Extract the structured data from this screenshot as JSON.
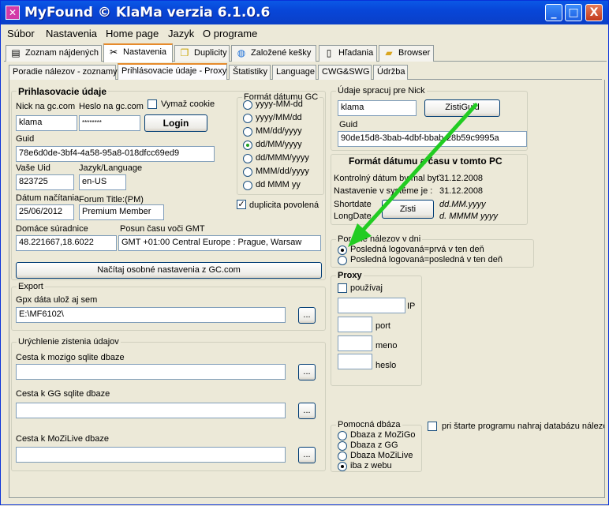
{
  "window": {
    "title": "MyFound © KlaMa verzia 6.1.0.6",
    "app_icon": "app-logo-icon",
    "controls": [
      "_",
      "□",
      "X"
    ]
  },
  "menu": [
    "Súbor",
    "Nastavenia",
    "Home page",
    "Jazyk",
    "O programe"
  ],
  "main_tabs": [
    {
      "label": "Zoznam nájdených",
      "icon": "document-icon"
    },
    {
      "label": "Nastavenia",
      "icon": "tools-icon"
    },
    {
      "label": "Duplicity",
      "icon": "duplicate-icon"
    },
    {
      "label": "Založené kešky",
      "icon": "globe-icon"
    },
    {
      "label": "Hľadania",
      "icon": "page-icon"
    },
    {
      "label": "Browser",
      "icon": "folder-icon"
    }
  ],
  "sub_tabs": [
    "Poradie nálezov - zoznamy",
    "Prihlásovacie údaje - Proxy",
    "Štatistiky",
    "Language",
    "CWG&SWG",
    "Údržba"
  ],
  "login": {
    "title": "Prihlasovacie údaje",
    "nick_label": "Nick na gc.com",
    "nick_value": "klama",
    "password_label": "Heslo na gc.com",
    "password_value": "********",
    "clear_cookie_label": "Vymaž cookie",
    "login_button": "Login",
    "guid_label": "Guid",
    "guid_value": "78e6d0de-3bf4-4a58-95a8-018dfcc69ed9",
    "uid_label": "Vaše Uid",
    "uid_value": "823725",
    "lang_label": "Jazyk/Language",
    "lang_value": "en-US",
    "load_date_label": "Dátum načítania",
    "load_date_value": "25/06/2012",
    "forum_title_label": "Forum Title:(PM)",
    "forum_title_value": "Premium Member",
    "home_coords_label": "Domáce súradnice",
    "home_coords_value": "48.221667,18.6022",
    "gmt_label": "Posun času voči GMT",
    "gmt_value": "GMT +01:00 Central Europe : Prague, Warsaw",
    "load_settings_button": "Načítaj osobné nastavenia z GC.com"
  },
  "date_format": {
    "title": "Formát dátumu GC",
    "options": [
      "yyyy-MM-dd",
      "yyyy/MM/dd",
      "MM/dd/yyyy",
      "dd/MM/yyyy",
      "dd/MMM/yyyy",
      "MMM/dd/yyyy",
      "dd MMM yy"
    ],
    "selected": 3,
    "duplicity_label": "duplicita povolená",
    "duplicity_checked": true
  },
  "export": {
    "title": "Export",
    "gpx_label": "Gpx dáta ulož aj sem",
    "gpx_value": "E:\\MF6102\\",
    "browse": "..."
  },
  "speedup": {
    "title": "Urýchlenie zistenia údajov",
    "mozigo_label": "Cesta k mozigo sqlite dbaze",
    "mozigo_value": "",
    "gg_label": "Cesta k GG sqlite dbaze",
    "gg_value": "",
    "mozilive_label": "Cesta k MoZiLive dbaze",
    "mozilive_value": "",
    "browse": "..."
  },
  "nick_data": {
    "title": "Údaje spracuj pre Nick",
    "nick_value": "klama",
    "find_guid_button": "ZistiGuid",
    "guid_label": "Guid",
    "guid_value": "90de15d8-3bab-4dbf-bbab-28b59c9995a"
  },
  "pc_datetime": {
    "title": "Formát dátumu a času v tomto PC",
    "control_date_label": "Kontrolný dátum by mal byť :",
    "control_date_value": "31.12.2008",
    "system_setting_label": "Nastavenie v systéme je :",
    "system_setting_value": "31.12.2008",
    "shortdate_label": "Shortdate",
    "shortdate_value": "dd.MM.yyyy",
    "longdate_label": "LongDate",
    "longdate_value": "d. MMMM yyyy",
    "find_button": "Zisti"
  },
  "day_order": {
    "title": "Poradie nálezov v dni",
    "options": [
      "Posledná logovaná=prvá v ten deň",
      "Posledná logovaná=posledná v ten deň"
    ],
    "selected": 0
  },
  "proxy": {
    "title": "Proxy",
    "use_label": "používaj",
    "use_checked": false,
    "ip_label": "IP",
    "ip_value": "",
    "port_label": "port",
    "port_value": "",
    "name_label": "meno",
    "name_value": "",
    "password_label": "heslo",
    "password_value": ""
  },
  "aux_db": {
    "title": "Pomocná dbáza",
    "options": [
      "Dbaza z MoZiGo",
      "Dbaza z GG",
      "Dbaza MoZiLive",
      "iba z webu"
    ],
    "selected": 3
  },
  "startup": {
    "label": "pri štarte programu nahraj databázu nálezov",
    "checked": false
  },
  "colors": {
    "arrow": "#22cc22",
    "titlebar": "#0a58e6",
    "tab_highlight": "#e68b2c"
  }
}
